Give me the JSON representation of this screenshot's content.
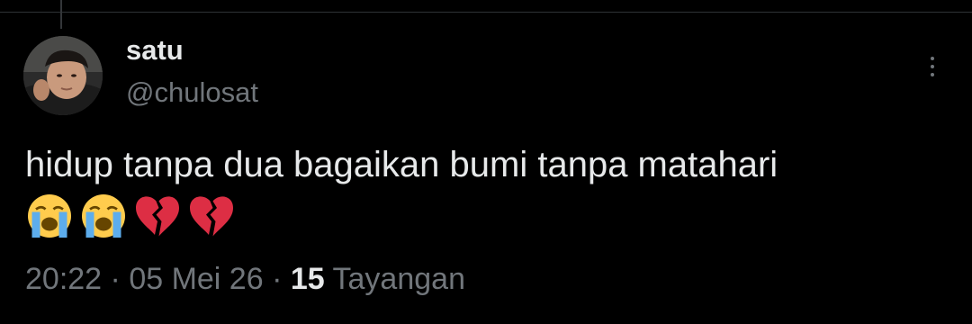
{
  "tweet": {
    "author": {
      "display_name": "satu",
      "handle": "@chulosat"
    },
    "text": "hidup tanpa dua bagaikan bumi tanpa matahari",
    "emojis": [
      "loudly-crying-face",
      "loudly-crying-face",
      "broken-heart",
      "broken-heart"
    ],
    "meta": {
      "time": "20:22",
      "separator": " · ",
      "date": "05 Mei 26",
      "views_count": "15",
      "views_label": " Tayangan"
    }
  },
  "icons": {
    "more": "more-vertical-icon"
  },
  "colors": {
    "background": "#000000",
    "primary_text": "#e7e9ea",
    "secondary_text": "#71767b",
    "divider": "#2f3336",
    "heart_red": "#dd2e44",
    "emoji_yellow": "#ffcc4d",
    "tear_blue": "#5dadec"
  }
}
